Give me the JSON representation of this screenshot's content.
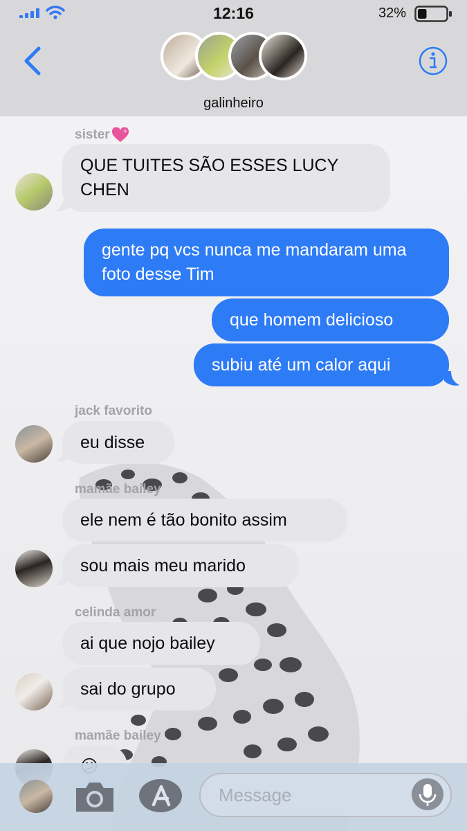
{
  "status_bar": {
    "time": "12:16",
    "battery_percent": "32%",
    "battery_level": 0.32
  },
  "header": {
    "group_name": "galinheiro",
    "back_icon": "chevron-left-icon",
    "info_icon": "info-icon"
  },
  "messages": [
    {
      "type": "label",
      "text": "sister"
    },
    {
      "type": "incoming",
      "text": "QUE TUITES SÃO ESSES LUCY CHEN"
    },
    {
      "type": "outgoing",
      "text": "gente pq vcs nunca me mandaram uma foto desse Tim"
    },
    {
      "type": "outgoing",
      "text": "que homem delicioso"
    },
    {
      "type": "outgoing",
      "text": "subiu até um calor aqui"
    },
    {
      "type": "label",
      "text": "jack favorito"
    },
    {
      "type": "incoming",
      "text": "eu disse"
    },
    {
      "type": "label",
      "text": "mamãe bailey"
    },
    {
      "type": "incoming",
      "text": "ele nem é tão bonito assim"
    },
    {
      "type": "incoming",
      "text": "sou mais meu marido"
    },
    {
      "type": "label",
      "text": "celinda amor"
    },
    {
      "type": "incoming",
      "text": "ai que nojo bailey"
    },
    {
      "type": "incoming",
      "text": "sai do grupo"
    },
    {
      "type": "label",
      "text": "mamãe bailey"
    },
    {
      "type": "incoming",
      "text": "😕"
    }
  ],
  "input_bar": {
    "placeholder": "Message"
  },
  "colors": {
    "outgoing_bubble": "#2e7bf6",
    "incoming_bubble": "#e6e5ea",
    "accent": "#2e7bf6"
  }
}
